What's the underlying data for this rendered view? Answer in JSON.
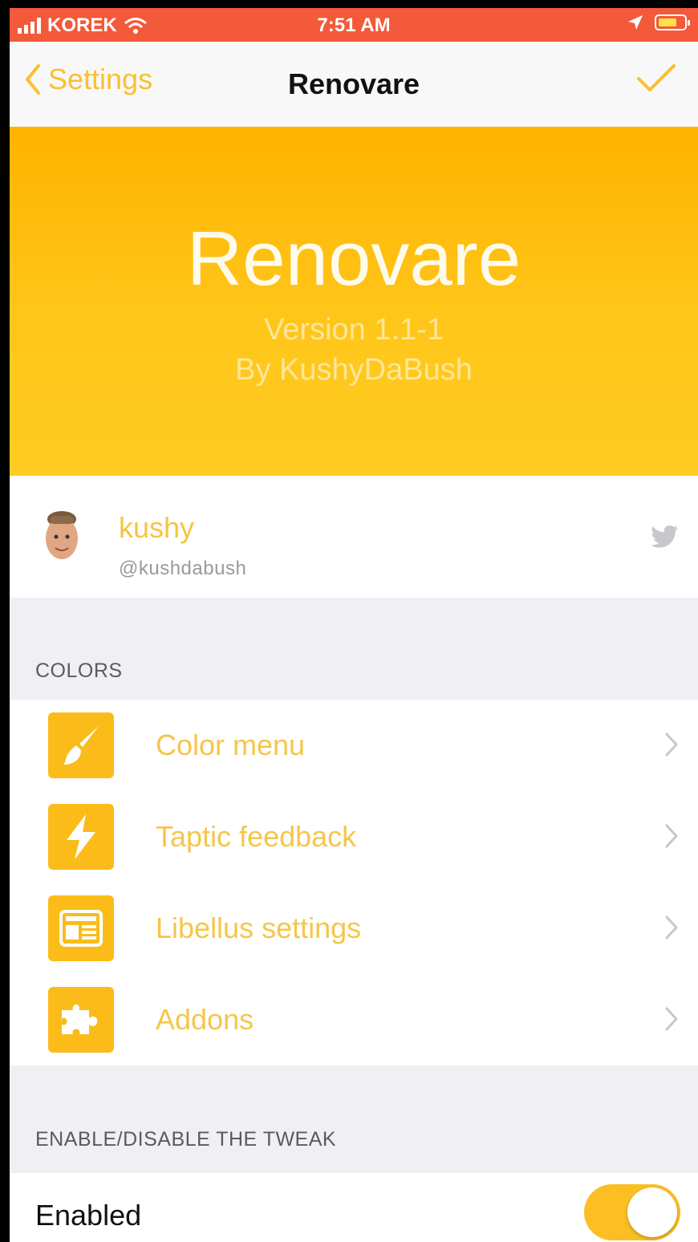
{
  "status_bar": {
    "carrier": "KOREK",
    "time": "7:51 AM",
    "colors": {
      "background": "#f25a3a"
    },
    "icons": [
      "signal-bars-icon",
      "wifi-icon",
      "location-arrow-icon",
      "battery-icon"
    ]
  },
  "nav": {
    "back_label": "Settings",
    "title": "Renovare",
    "icons": [
      "chevron-left-icon",
      "checkmark-icon"
    ]
  },
  "banner": {
    "title": "Renovare",
    "version": "Version 1.1-1",
    "author": "By KushyDaBush"
  },
  "profile": {
    "name": "kushy",
    "handle": "@kushdabush",
    "icons": [
      "avatar",
      "twitter-icon"
    ]
  },
  "colors_section": {
    "header": "COLORS",
    "items": [
      {
        "label": "Color menu",
        "icon": "paintbrush-icon"
      },
      {
        "label": "Taptic feedback",
        "icon": "lightning-icon"
      },
      {
        "label": "Libellus settings",
        "icon": "newspaper-icon"
      },
      {
        "label": "Addons",
        "icon": "puzzle-icon"
      }
    ]
  },
  "tweak_section": {
    "header": "ENABLE/DISABLE THE TWEAK",
    "enabled_label": "Enabled",
    "enabled": true
  },
  "theme": {
    "accent": "#fbbc1a",
    "banner": "#ffc000"
  }
}
